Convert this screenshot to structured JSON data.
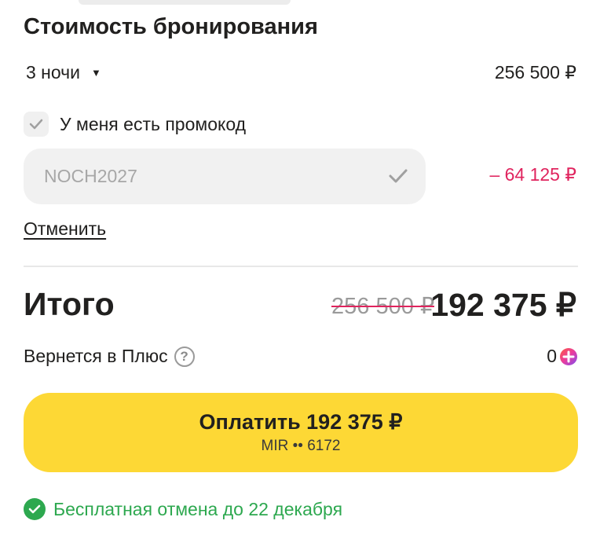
{
  "booking": {
    "title": "Стоимость бронирования",
    "nights_label": "3 ночи",
    "nights_price": "256 500 ₽"
  },
  "promo": {
    "checkbox_label": "У меня есть промокод",
    "checked": true,
    "code_value": "NOCH2027",
    "discount": "– 64 125 ₽",
    "cancel_label": "Отменить"
  },
  "total": {
    "label": "Итого",
    "old_price": "256 500 ₽",
    "price": "192 375 ₽",
    "cashback_label": "Вернется в Плюс",
    "help_symbol": "?",
    "cashback_value": "0"
  },
  "pay": {
    "label": "Оплатить 192 375 ₽",
    "card": "MIR •• 6172",
    "color": "#fdd835"
  },
  "footer": {
    "free_cancel": "Бесплатная отмена до 22 декабря",
    "color": "#2da84f"
  },
  "colors": {
    "discount": "#e0245e",
    "text": "#21201f"
  }
}
